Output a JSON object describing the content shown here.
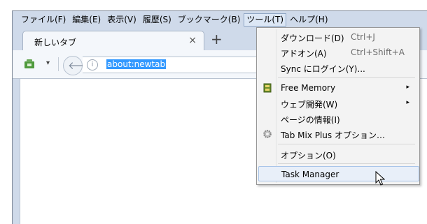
{
  "menubar": {
    "items": [
      {
        "label": "ファイル(F)"
      },
      {
        "label": "編集(E)"
      },
      {
        "label": "表示(V)"
      },
      {
        "label": "履歴(S)"
      },
      {
        "label": "ブックマーク(B)"
      },
      {
        "label": "ツール(T)"
      },
      {
        "label": "ヘルプ(H)"
      }
    ]
  },
  "tab": {
    "title": "新しいタブ",
    "close": "×",
    "new_tab": "+"
  },
  "navbar": {
    "url": "about:newtab",
    "info": "i",
    "back": "🡐",
    "dropdown": "▾"
  },
  "tools_menu": {
    "items": [
      {
        "label": "ダウンロード(D)",
        "shortcut": "Ctrl+J"
      },
      {
        "label": "アドオン(A)",
        "shortcut": "Ctrl+Shift+A"
      },
      {
        "label": "Sync にログイン(Y)..."
      },
      {
        "label": "Free Memory",
        "submenu": "▸"
      },
      {
        "label": "ウェブ開発(W)",
        "submenu": "▸"
      },
      {
        "label": "ページの情報(I)"
      },
      {
        "label": "Tab Mix Plus オプション…"
      },
      {
        "label": "オプション(O)"
      },
      {
        "label": "Task Manager"
      }
    ]
  },
  "colors": {
    "accent": "#3399ff",
    "window_frame": "#cfdaea"
  }
}
